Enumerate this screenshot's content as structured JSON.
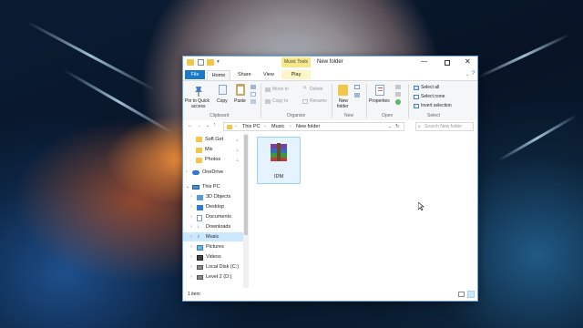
{
  "window": {
    "title": "New folder",
    "context_tab": "Music Tools"
  },
  "ribbon_tabs": [
    "File",
    "Home",
    "Share",
    "View",
    "Play"
  ],
  "ribbon": {
    "clipboard": {
      "pin": "Pin to Quick",
      "pin2": "access",
      "copy": "Copy",
      "paste": "Paste",
      "group": "Clipboard"
    },
    "organize": {
      "move_to": "Move to",
      "copy_to": "Copy to",
      "delete": "Delete",
      "rename": "Rename",
      "group": "Organize"
    },
    "new": {
      "new_folder": "New",
      "new_folder2": "folder",
      "group": "New"
    },
    "open": {
      "properties": "Properties",
      "group": "Open"
    },
    "select": {
      "select_all": "Select all",
      "select_none": "Select none",
      "invert": "Invert selection",
      "group": "Select"
    }
  },
  "address": {
    "crumbs": [
      "This PC",
      "Music",
      "New folder"
    ],
    "search_placeholder": "Search New folder"
  },
  "nav": {
    "quick": [
      "Soft Get",
      "Mix",
      "Photos"
    ],
    "onedrive": "OneDrive",
    "thispc": "This PC",
    "items": [
      "3D Objects",
      "Desktop",
      "Documents",
      "Downloads",
      "Music",
      "Pictures",
      "Videos",
      "Local Disk (C:)",
      "Level 2 (D:)"
    ]
  },
  "files": [
    {
      "name": "IDM"
    }
  ],
  "status": {
    "count": "1 item"
  }
}
